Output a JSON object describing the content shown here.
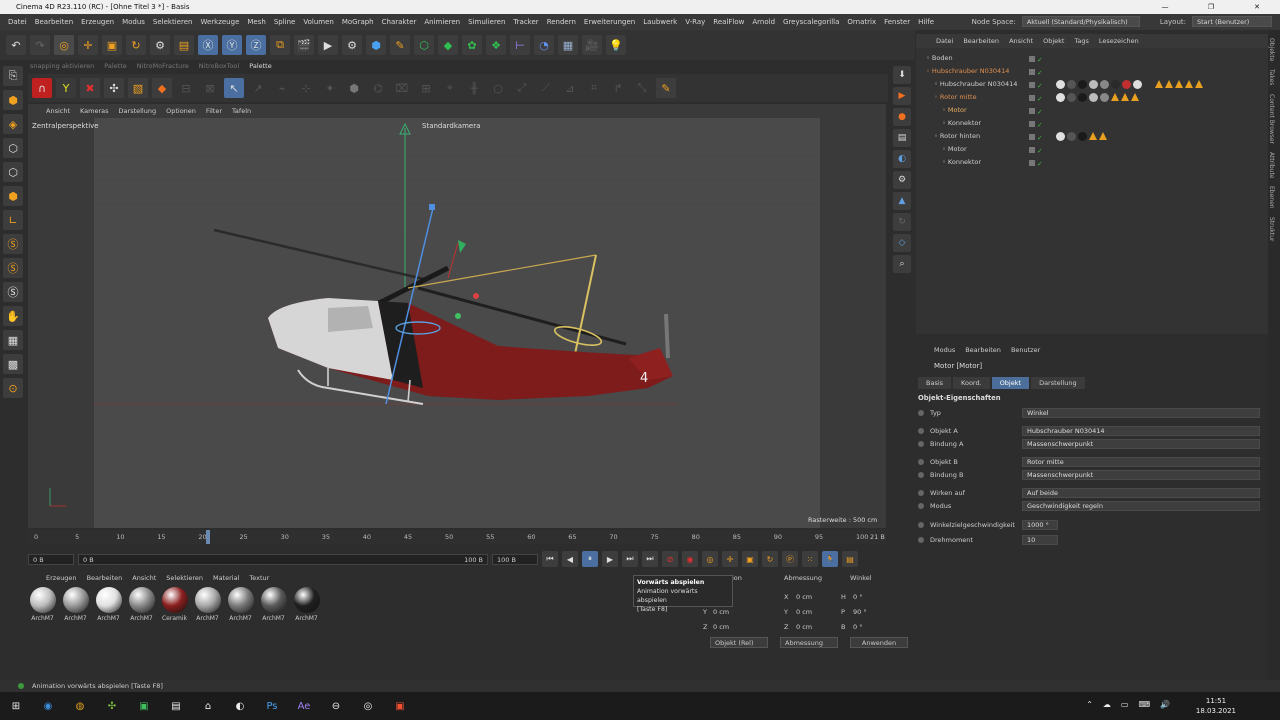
{
  "app": {
    "title": "Cinema 4D R23.110 (RC) - [Ohne Titel 3 *] - Basis",
    "menu": [
      "Datei",
      "Bearbeiten",
      "Erzeugen",
      "Modus",
      "Selektieren",
      "Werkzeuge",
      "Mesh",
      "Spline",
      "Volumen",
      "MoGraph",
      "Charakter",
      "Animieren",
      "Simulieren",
      "Tracker",
      "Rendern",
      "Erweiterungen",
      "Laubwerk",
      "V-Ray",
      "RealFlow",
      "Arnold",
      "Greyscalegorilla",
      "Ornatrix",
      "Fenster",
      "Hilfe"
    ],
    "node_space_label": "Node Space:",
    "node_space_value": "Aktuell (Standard/Physikalisch)",
    "layout_label": "Layout:",
    "layout_value": "Start (Benutzer)"
  },
  "palette_tabs": [
    "snapping aktivieren",
    "Palette",
    "NitroMoFracture",
    "NitroBoxTool",
    "Palette"
  ],
  "viewport": {
    "menu": [
      "Ansicht",
      "Kameras",
      "Darstellung",
      "Optionen",
      "Filter",
      "Tafeln"
    ],
    "view_name": "Zentralperspektive",
    "camera": "Standardkamera",
    "raster": "Rasterweite : 500 cm",
    "heli_number": "4"
  },
  "timeline": {
    "ticks": [
      "0",
      "5",
      "10",
      "15",
      "20",
      "25",
      "30",
      "35",
      "40",
      "45",
      "50",
      "55",
      "60",
      "65",
      "70",
      "75",
      "80",
      "85",
      "90",
      "95",
      "100"
    ],
    "current_frame_label": "21 B",
    "start_field": "0 B",
    "min_field": "0 B",
    "max_field": "100 B",
    "end_field": "100 B"
  },
  "materials": {
    "menu": [
      "Erzeugen",
      "Bearbeiten",
      "Ansicht",
      "Selektieren",
      "Material",
      "Textur"
    ],
    "items": [
      {
        "label": "ArchM7",
        "color": "#bdbdbd"
      },
      {
        "label": "ArchM7",
        "color": "#9a9a9a"
      },
      {
        "label": "ArchM7",
        "color": "#e0e0e0"
      },
      {
        "label": "ArchM7",
        "color": "#8a8a8a"
      },
      {
        "label": "Ceramik",
        "color": "#8a1e1e"
      },
      {
        "label": "ArchM7",
        "color": "#a8a8a8"
      },
      {
        "label": "ArchM7",
        "color": "#7a7a7a"
      },
      {
        "label": "ArchM7",
        "color": "#5a5a5a"
      },
      {
        "label": "ArchM7",
        "color": "#202020"
      }
    ]
  },
  "coords": {
    "headers": [
      "ion",
      "Abmessung",
      "Winkel"
    ],
    "rows": [
      {
        "axis": "X",
        "pos": "0 cm",
        "rot_axis": "H",
        "rot": "0 °"
      },
      {
        "axis": "Y",
        "size": "0 cm",
        "pos": "0 cm",
        "rot_axis": "P",
        "rot": "90 °"
      },
      {
        "axis": "Z",
        "size": "0 cm",
        "pos": "0 cm",
        "rot_axis": "B",
        "rot": "0 °"
      }
    ],
    "mode_btn": "Objekt (Rel)",
    "size_btn": "Abmessung",
    "apply_btn": "Anwenden"
  },
  "tooltip": {
    "title": "Vorwärts abspielen",
    "line1": "Animation vorwärts abspielen",
    "line2": "[Taste F8]"
  },
  "status": "Animation vorwärts abspielen [Taste F8]",
  "objects": {
    "menu": [
      "Datei",
      "Bearbeiten",
      "Ansicht",
      "Objekt",
      "Tags",
      "Lesezeichen"
    ],
    "items": [
      {
        "name": "Boden",
        "indent": 0,
        "color": "#cfcfcf",
        "tags": []
      },
      {
        "name": "Hubschrauber N030414",
        "indent": 0,
        "color": "#e09050",
        "tags": []
      },
      {
        "name": "Hubschrauber N030414",
        "indent": 1,
        "color": "#cfcfcf",
        "tags": [
          "s",
          "s",
          "s",
          "s",
          "s",
          "s",
          "s",
          "s",
          "s",
          "t",
          "t",
          "t",
          "t",
          "t"
        ]
      },
      {
        "name": "Rotor mitte",
        "indent": 1,
        "color": "#e09050",
        "tags": [
          "s",
          "s",
          "s",
          "s",
          "s",
          "t",
          "t",
          "t"
        ]
      },
      {
        "name": "Motor",
        "indent": 2,
        "color": "#e8b060",
        "tags": []
      },
      {
        "name": "Konnektor",
        "indent": 2,
        "color": "#cfcfcf",
        "tags": []
      },
      {
        "name": "Rotor hinten",
        "indent": 1,
        "color": "#cfcfcf",
        "tags": [
          "s",
          "s",
          "s",
          "t",
          "t"
        ]
      },
      {
        "name": "Motor",
        "indent": 2,
        "color": "#cfcfcf",
        "tags": []
      },
      {
        "name": "Konnektor",
        "indent": 2,
        "color": "#cfcfcf",
        "tags": []
      }
    ]
  },
  "attributes": {
    "menu": [
      "Modus",
      "Bearbeiten",
      "Benutzer"
    ],
    "title": "Motor [Motor]",
    "tabs": [
      "Basis",
      "Koord.",
      "Objekt",
      "Darstellung"
    ],
    "active_tab": "Objekt",
    "section": "Objekt-Eigenschaften",
    "rows": [
      {
        "label": "Typ",
        "value": "Winkel"
      },
      {
        "label": "Objekt A",
        "value": "Hubschrauber N030414"
      },
      {
        "label": "Bindung A",
        "value": "Massenschwerpunkt"
      },
      {
        "label": "Objekt B",
        "value": "Rotor mitte"
      },
      {
        "label": "Bindung B",
        "value": "Massenschwerpunkt"
      },
      {
        "label": "Wirken auf",
        "value": "Auf beide"
      },
      {
        "label": "Modus",
        "value": "Geschwindigkeit regeln"
      },
      {
        "label": "Winkelzielgeschwindigkeit",
        "value": "1000 °"
      },
      {
        "label": "Drehmoment",
        "value": "10"
      }
    ]
  },
  "right_strip": [
    "Objekte",
    "Takes",
    "Content Browser",
    "Attribute",
    "Ebenen",
    "Struktur"
  ],
  "taskbar": {
    "time": "11:51",
    "date": "18.03.2021"
  }
}
